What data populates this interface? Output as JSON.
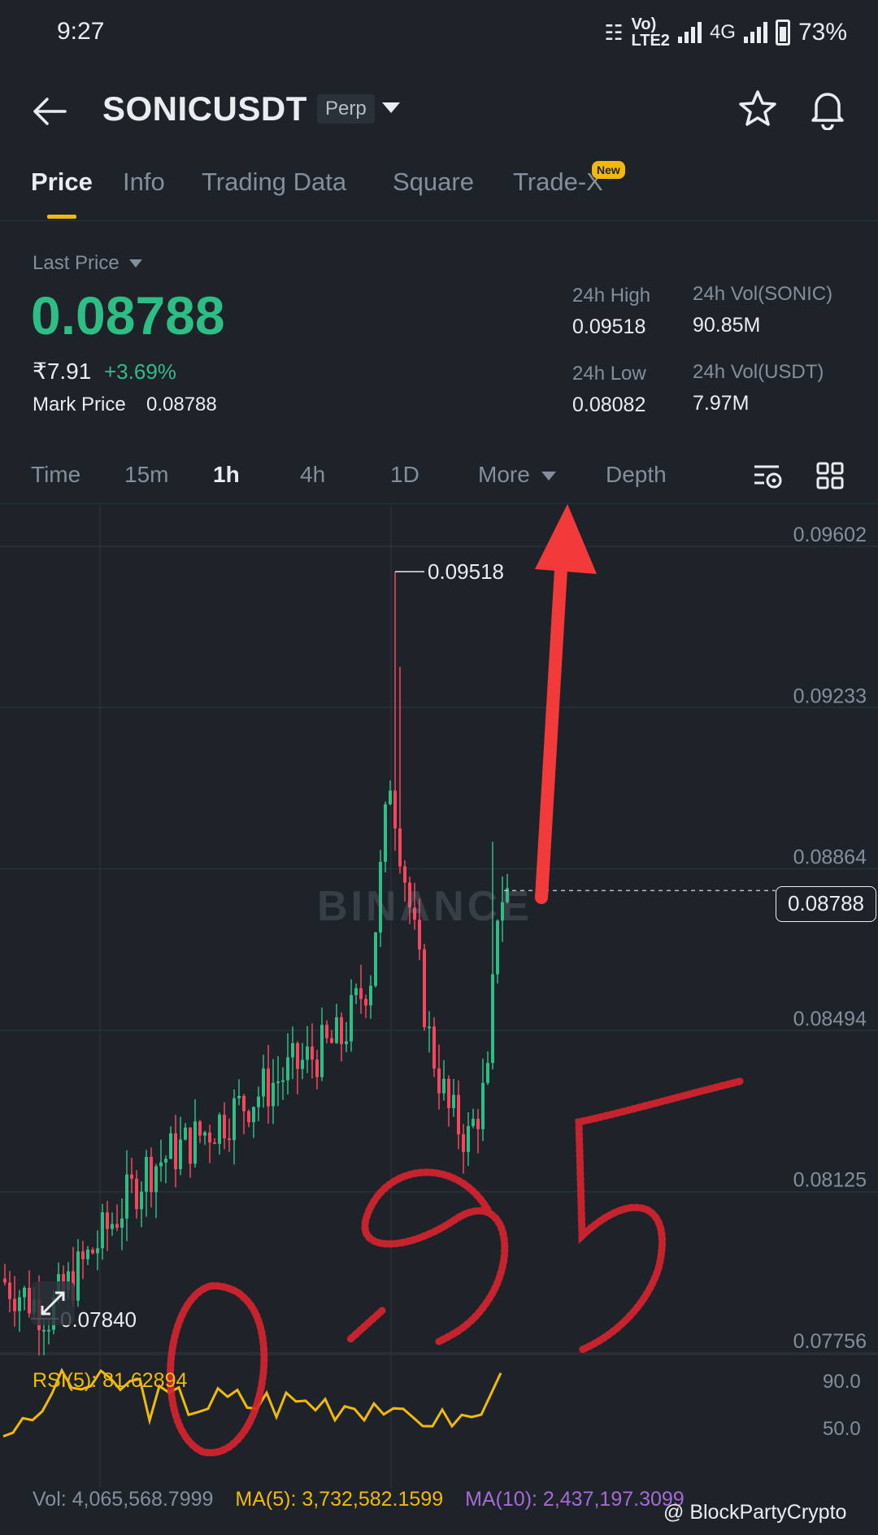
{
  "status_bar": {
    "time": "9:27",
    "network": "4G",
    "volte": "Vo) LTE2",
    "battery": "73%"
  },
  "header": {
    "pair": "SONICUSDT",
    "badge": "Perp"
  },
  "tabs": [
    {
      "label": "Price"
    },
    {
      "label": "Info"
    },
    {
      "label": "Trading Data"
    },
    {
      "label": "Square"
    },
    {
      "label": "Trade-X"
    }
  ],
  "new_badge": "New",
  "price": {
    "last_price_label": "Last Price",
    "last_price": "0.08788",
    "inr_price": "₹7.91",
    "change_pct": "+3.69%",
    "mark_price_label": "Mark Price",
    "mark_price": "0.08788",
    "high_label": "24h High",
    "high": "0.09518",
    "low_label": "24h Low",
    "low": "0.08082",
    "vol_base_label": "24h Vol(SONIC)",
    "vol_base": "90.85M",
    "vol_quote_label": "24h Vol(USDT)",
    "vol_quote": "7.97M"
  },
  "intervals": [
    "Time",
    "15m",
    "1h",
    "4h",
    "1D",
    "More",
    "Depth"
  ],
  "chart": {
    "price_scale": [
      "0.09602",
      "0.09233",
      "0.08864",
      "0.08494",
      "0.08125",
      "0.07756"
    ],
    "high_marker": "0.09518",
    "low_marker": "0.07840",
    "current_price": "0.08788",
    "watermark": "BINANCE",
    "colors": {
      "up": "#2ebd85",
      "down": "#f6465d",
      "rsi": "#f0b90b"
    }
  },
  "indicators": {
    "rsi_label": "RSI(5): 81.62894",
    "rsi_scale": [
      "90.0",
      "50.0"
    ],
    "vol": "Vol: 4,065,568.7999",
    "ma5": "MA(5): 3,732,582.1599",
    "ma10": "MA(10): 2,437,197.3099"
  },
  "annotation": {
    "handwritten": "0.95"
  },
  "credit": "@ BlockPartyCrypto"
}
